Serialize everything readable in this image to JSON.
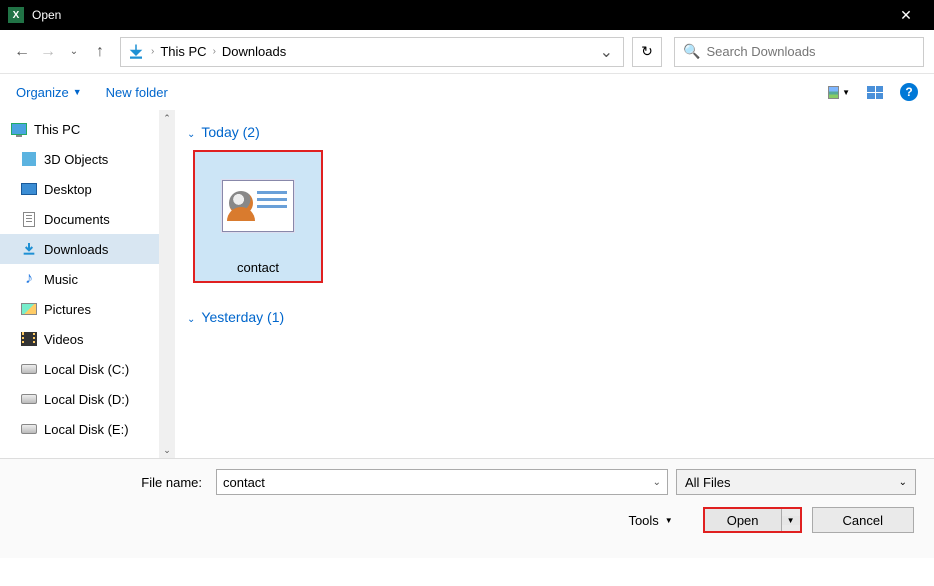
{
  "titlebar": {
    "title": "Open"
  },
  "nav": {
    "crumbs": [
      "This PC",
      "Downloads"
    ],
    "search_placeholder": "Search Downloads"
  },
  "toolbar": {
    "organize": "Organize",
    "new_folder": "New folder"
  },
  "tree": {
    "root": "This PC",
    "items": [
      {
        "label": "3D Objects"
      },
      {
        "label": "Desktop"
      },
      {
        "label": "Documents"
      },
      {
        "label": "Downloads",
        "selected": true
      },
      {
        "label": "Music"
      },
      {
        "label": "Pictures"
      },
      {
        "label": "Videos"
      },
      {
        "label": "Local Disk (C:)"
      },
      {
        "label": "Local Disk (D:)"
      },
      {
        "label": "Local Disk (E:)"
      }
    ]
  },
  "content": {
    "groups": [
      {
        "header": "Today (2)",
        "files": [
          {
            "name": "contact",
            "selected": true
          }
        ]
      },
      {
        "header": "Yesterday (1)",
        "files": []
      }
    ]
  },
  "bottom": {
    "filename_label": "File name:",
    "filename_value": "contact",
    "filter": "All Files",
    "tools": "Tools",
    "open": "Open",
    "cancel": "Cancel"
  }
}
